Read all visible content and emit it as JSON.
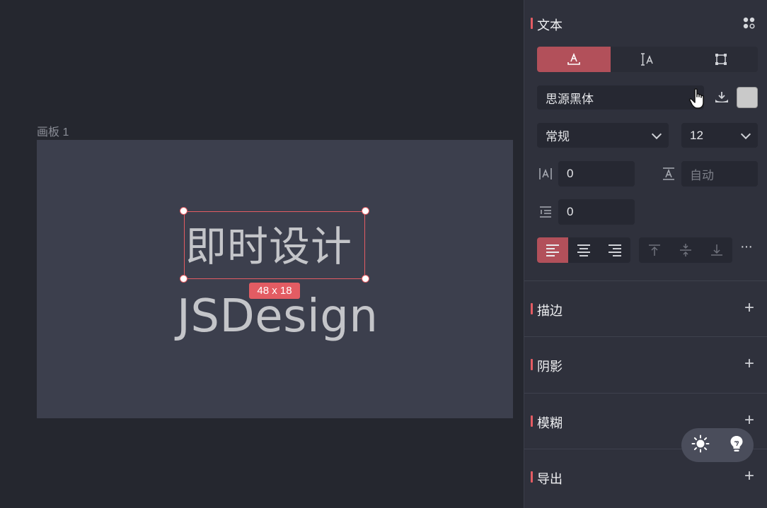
{
  "canvas": {
    "board_label": "画板 1",
    "selected_text": "即时设计",
    "size_badge": "48 x 18",
    "big_text": "JSDesign"
  },
  "panel": {
    "text_section": {
      "title": "文本",
      "font_family": "思源黑体",
      "font_weight": "常规",
      "font_size": "12",
      "letter_spacing": "0",
      "line_height_placeholder": "自动",
      "paragraph_spacing": "0"
    },
    "sections": {
      "stroke": "描边",
      "shadow": "阴影",
      "blur": "模糊",
      "export": "导出"
    },
    "plus": "+",
    "more": "···"
  },
  "colors": {
    "accent": "#e35c63",
    "active_segment": "#b2505a",
    "panel_bg": "#2f313c",
    "board_bg": "#3c3f4d",
    "text_fill": "#c9c9c9"
  },
  "icons": [
    "text-box-icon",
    "text-auto-height-icon",
    "frame-icon",
    "components-icon",
    "font-download-icon",
    "pointer-hand-icon",
    "letter-spacing-icon",
    "line-height-icon",
    "paragraph-spacing-icon",
    "align-left-icon",
    "align-center-icon",
    "align-right-icon",
    "align-top-icon",
    "align-middle-icon",
    "align-bottom-icon",
    "sun-icon",
    "bulb-icon"
  ]
}
